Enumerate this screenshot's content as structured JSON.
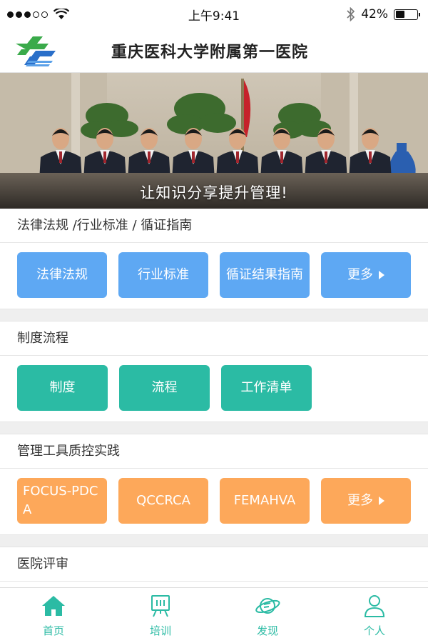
{
  "status_bar": {
    "time": "上午9:41",
    "battery": "42%",
    "battery_fraction": 0.42
  },
  "header": {
    "title": "重庆医科大学附属第一医院"
  },
  "banner": {
    "caption": "让知识分享提升管理!"
  },
  "sections": [
    {
      "title": "法律法规 /行业标准 / 循证指南",
      "buttons": [
        "法律法规",
        "行业标准",
        "循证结果指南",
        "更多"
      ]
    },
    {
      "title": "制度流程",
      "buttons": [
        "制度",
        "流程",
        "工作清单"
      ]
    },
    {
      "title": "管理工具质控实践",
      "buttons": [
        "FOCUS-PDCA",
        "QCCRCA",
        "FEMAHVA",
        "更多"
      ]
    },
    {
      "title": "医院评审"
    }
  ],
  "tabbar": {
    "items": [
      {
        "label": "首页",
        "icon": "home-icon"
      },
      {
        "label": "培训",
        "icon": "training-board-icon"
      },
      {
        "label": "发现",
        "icon": "planet-icon"
      },
      {
        "label": "个人",
        "icon": "person-icon"
      }
    ],
    "color": "#2bbba4"
  },
  "colors": {
    "blue": "#5ea8f3",
    "teal": "#2bbba4",
    "orange": "#fda85a",
    "red": "#f47a7a"
  }
}
